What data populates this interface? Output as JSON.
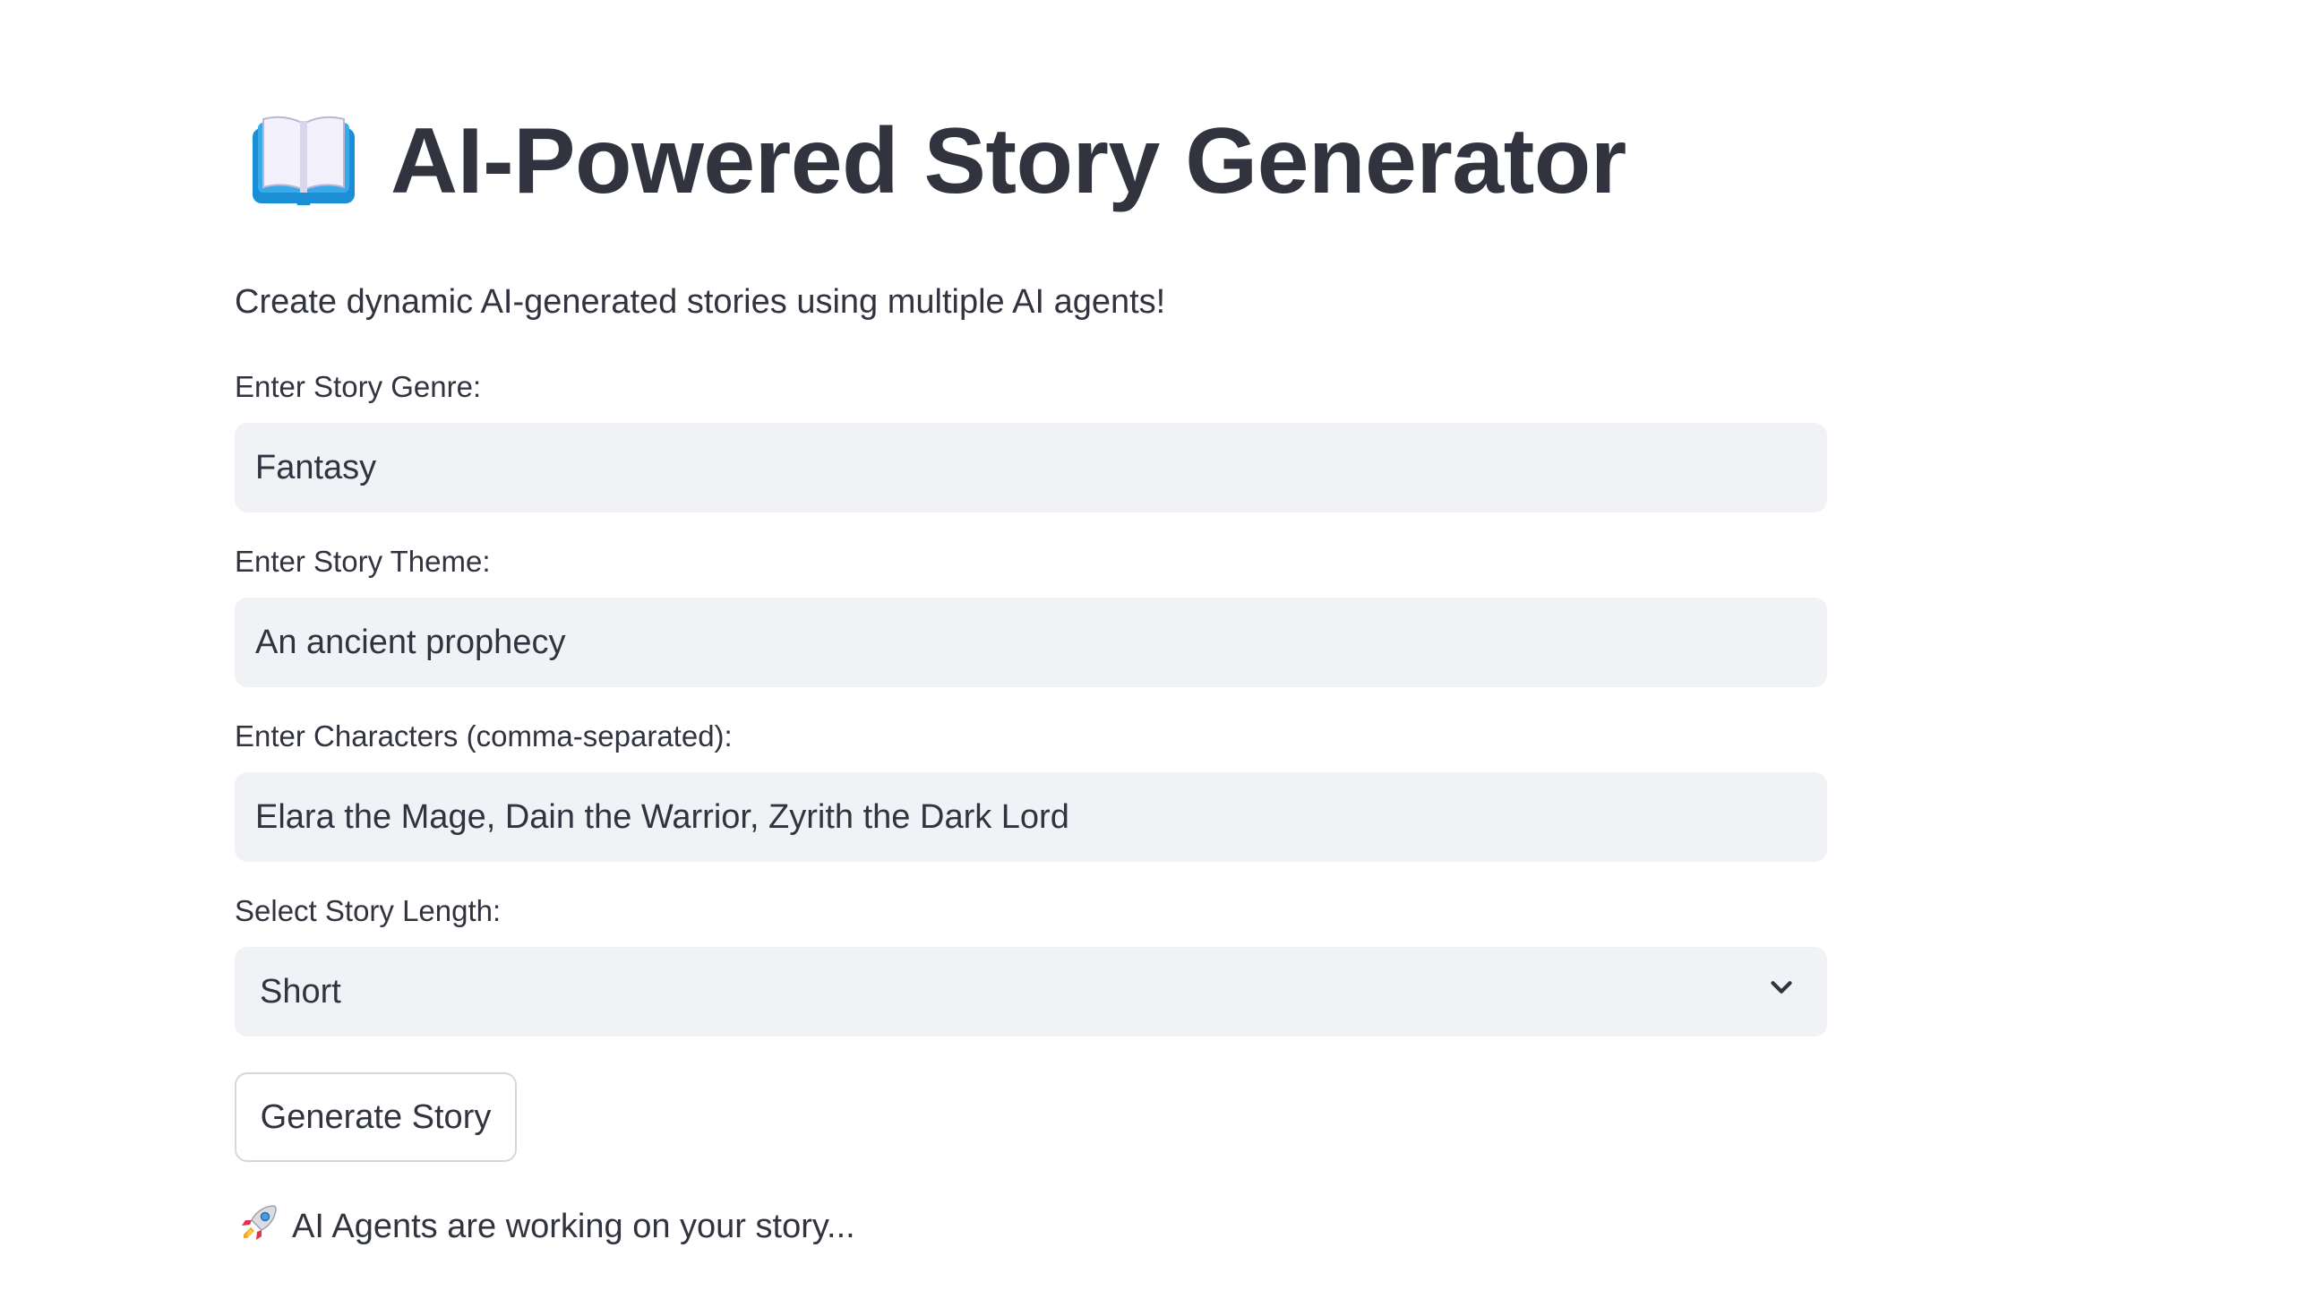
{
  "header": {
    "icon": "open-book-icon",
    "title": "AI-Powered Story Generator",
    "subtitle": "Create dynamic AI-generated stories using multiple AI agents!"
  },
  "form": {
    "genre": {
      "label": "Enter Story Genre:",
      "value": "Fantasy"
    },
    "theme": {
      "label": "Enter Story Theme:",
      "value": "An ancient prophecy"
    },
    "characters": {
      "label": "Enter Characters (comma-separated):",
      "value": "Elara the Mage, Dain the Warrior, Zyrith the Dark Lord"
    },
    "length": {
      "label": "Select Story Length:",
      "selected": "Short",
      "icon": "chevron-down-icon"
    },
    "generate_button": "Generate Story"
  },
  "status": {
    "icon": "rocket-icon",
    "text": "AI Agents are working on your story..."
  },
  "colors": {
    "text": "#31333f",
    "input_bg": "#f0f2f6",
    "button_border": "#d5d7dd",
    "background": "#ffffff"
  }
}
